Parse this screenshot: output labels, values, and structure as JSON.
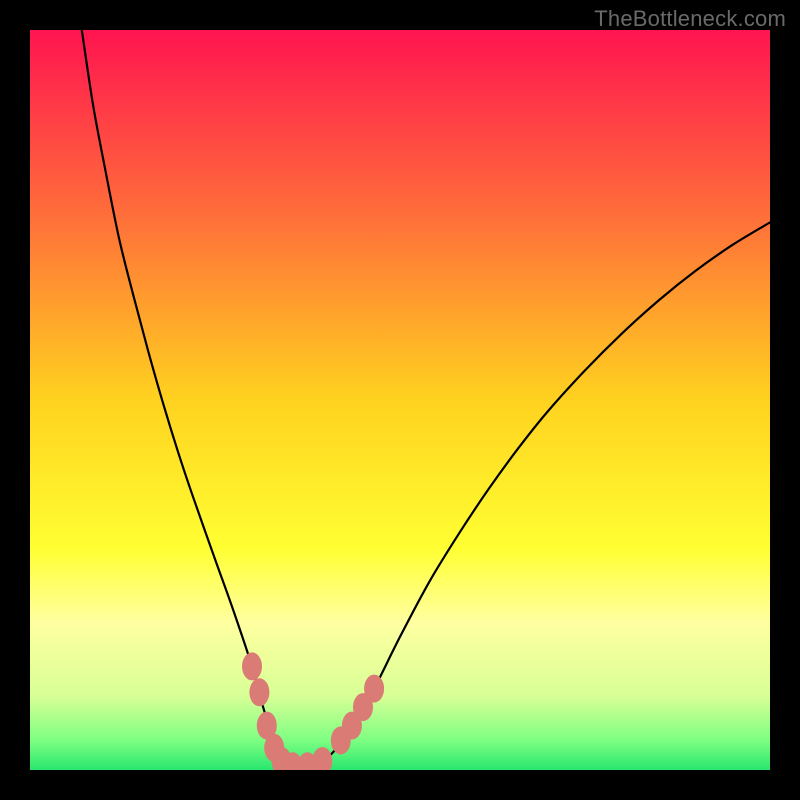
{
  "watermark": "TheBottleneck.com",
  "chart_data": {
    "type": "line",
    "title": "",
    "xlabel": "",
    "ylabel": "",
    "xlim": [
      0,
      100
    ],
    "ylim": [
      0,
      100
    ],
    "grid": false,
    "legend": false,
    "background_gradient": {
      "stops": [
        {
          "offset": 0.0,
          "color": "#ff1450"
        },
        {
          "offset": 0.25,
          "color": "#ff6e3a"
        },
        {
          "offset": 0.5,
          "color": "#ffd21f"
        },
        {
          "offset": 0.7,
          "color": "#ffff32"
        },
        {
          "offset": 0.8,
          "color": "#ffffa0"
        },
        {
          "offset": 0.9,
          "color": "#d8ff96"
        },
        {
          "offset": 0.96,
          "color": "#7dff82"
        },
        {
          "offset": 1.0,
          "color": "#28e66e"
        }
      ]
    },
    "series": [
      {
        "name": "bottleneck-curve",
        "x": [
          7.0,
          8.5,
          10.0,
          12.0,
          14.0,
          16.0,
          18.0,
          20.0,
          22.0,
          25.0,
          27.5,
          30.0,
          31.5,
          33.0,
          35.0,
          37.0,
          40.0,
          43.0,
          46.0,
          50.0,
          54.0,
          58.0,
          62.0,
          66.0,
          70.0,
          75.0,
          80.0,
          85.0,
          90.0,
          95.0,
          100.0
        ],
        "y": [
          100.0,
          90.0,
          82.0,
          72.0,
          64.0,
          56.5,
          49.5,
          43.0,
          37.0,
          28.5,
          21.5,
          14.0,
          8.5,
          4.0,
          0.8,
          0.3,
          1.5,
          5.0,
          10.0,
          18.0,
          25.5,
          32.0,
          38.0,
          43.5,
          48.5,
          54.0,
          59.0,
          63.5,
          67.5,
          71.0,
          74.0
        ]
      }
    ],
    "markers": {
      "name": "highlighted-points",
      "color": "#da7b76",
      "points": [
        {
          "x": 30.0,
          "y": 14.0
        },
        {
          "x": 31.0,
          "y": 10.5
        },
        {
          "x": 32.0,
          "y": 6.0
        },
        {
          "x": 33.0,
          "y": 3.0
        },
        {
          "x": 34.0,
          "y": 1.2
        },
        {
          "x": 35.5,
          "y": 0.5
        },
        {
          "x": 37.5,
          "y": 0.5
        },
        {
          "x": 39.5,
          "y": 1.2
        },
        {
          "x": 42.0,
          "y": 4.0
        },
        {
          "x": 43.5,
          "y": 6.0
        },
        {
          "x": 45.0,
          "y": 8.5
        },
        {
          "x": 46.5,
          "y": 11.0
        }
      ]
    }
  }
}
